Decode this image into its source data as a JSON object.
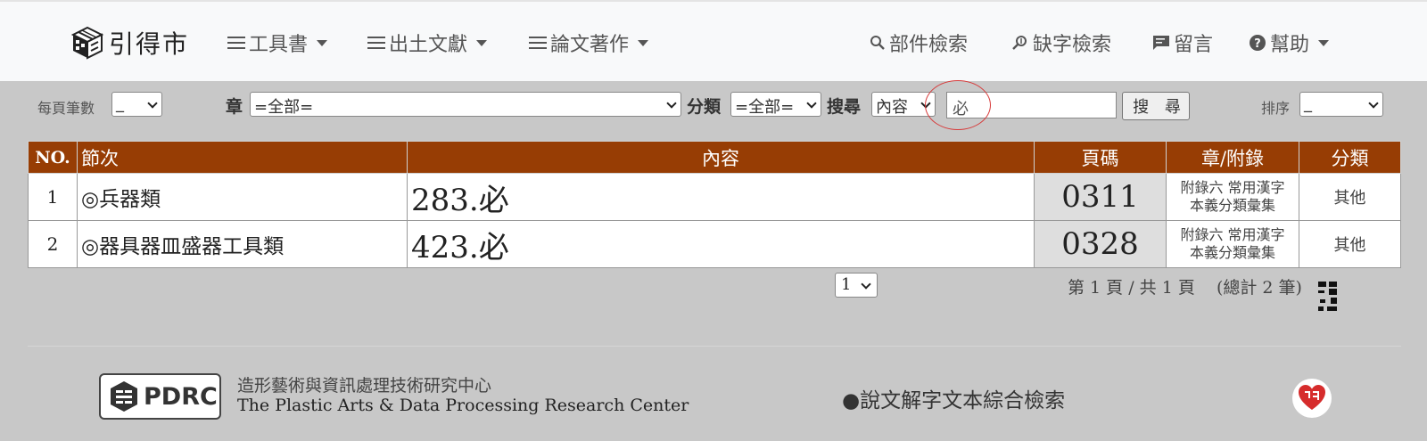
{
  "brand": {
    "name": "引得市"
  },
  "nav": {
    "tools": "工具書",
    "excavated": "出土文獻",
    "papers": "論文著作",
    "component_search": "部件檢索",
    "missing_char_search": "缺字檢索",
    "message": "留言",
    "help": "幫助"
  },
  "filters": {
    "per_page_label": "每頁筆數",
    "per_page_value": "_",
    "chapter_label": "章",
    "chapter_value": "=全部=",
    "category_label": "分類",
    "category_value": "=全部=",
    "search_label": "搜尋",
    "field_value": "內容",
    "query_value": "必",
    "search_button": "搜 尋",
    "sort_label": "排序",
    "sort_value": "_"
  },
  "table": {
    "headers": {
      "no": "NO.",
      "section": "節次",
      "content": "內容",
      "page": "頁碼",
      "chapter": "章/附錄",
      "category": "分類"
    },
    "rows": [
      {
        "no": "1",
        "section": "◎兵器類",
        "content": "283.必",
        "page": "0311",
        "chapter_line1": "附錄六 常用漢字",
        "chapter_line2": "本義分類彙集",
        "category": "其他"
      },
      {
        "no": "2",
        "section": "◎器具器皿盛器工具類",
        "content": "423.必",
        "page": "0328",
        "chapter_line1": "附錄六 常用漢字",
        "chapter_line2": "本義分類彙集",
        "category": "其他"
      }
    ]
  },
  "pager": {
    "page_select": "1",
    "summary": "第 1 頁 / 共 1 頁    (總計 2 筆)"
  },
  "footer": {
    "logo_text": "PDRC",
    "org_zh": "造形藝術與資訊處理技術研究中心",
    "org_en": "The Plastic Arts & Data Processing Research Center",
    "link": "●說文解字文本綜合檢索"
  },
  "colors": {
    "header_bg": "#973d04",
    "circle_mark": "#d73a3a",
    "badge": "#d62c2c"
  }
}
